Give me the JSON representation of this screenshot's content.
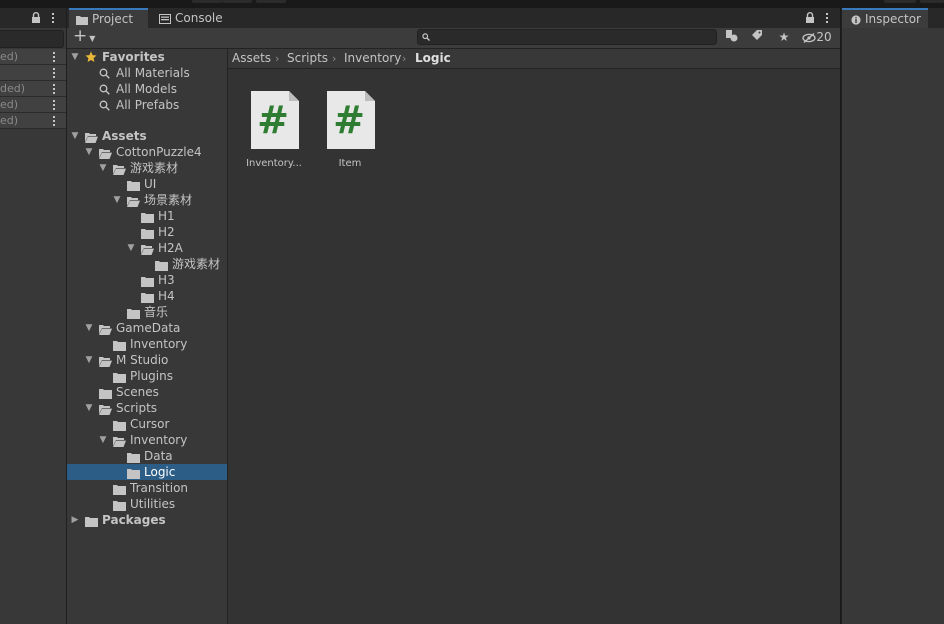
{
  "hierarchy": {
    "rows": [
      "ed)",
      "",
      "ded)",
      "ed)",
      "ed)"
    ]
  },
  "project": {
    "tabs": [
      {
        "label": "Project",
        "icon": "folder-icon",
        "active": true
      },
      {
        "label": "Console",
        "icon": "console-icon",
        "active": false
      }
    ],
    "search_placeholder": "",
    "hidden_count": "20",
    "tree": [
      {
        "label": "Favorites",
        "icon": "star-icon",
        "bold": true,
        "expanded": true
      },
      {
        "label": "All Materials",
        "icon": "search-icon"
      },
      {
        "label": "All Models",
        "icon": "search-icon"
      },
      {
        "label": "All Prefabs",
        "icon": "search-icon"
      },
      {
        "label": "Assets",
        "icon": "folder-open-icon",
        "bold": true,
        "expanded": true
      },
      {
        "label": "CottonPuzzle4",
        "icon": "folder-open-icon",
        "expanded": true
      },
      {
        "label": "游戏素材",
        "icon": "folder-open-icon",
        "expanded": true
      },
      {
        "label": "UI",
        "icon": "folder-icon"
      },
      {
        "label": "场景素材",
        "icon": "folder-open-icon",
        "expanded": true
      },
      {
        "label": "H1",
        "icon": "folder-icon"
      },
      {
        "label": "H2",
        "icon": "folder-icon"
      },
      {
        "label": "H2A",
        "icon": "folder-open-icon",
        "expanded": true
      },
      {
        "label": "游戏素材",
        "icon": "folder-icon"
      },
      {
        "label": "H3",
        "icon": "folder-icon"
      },
      {
        "label": "H4",
        "icon": "folder-icon"
      },
      {
        "label": "音乐",
        "icon": "folder-icon"
      },
      {
        "label": "GameData",
        "icon": "folder-open-icon",
        "expanded": true
      },
      {
        "label": "Inventory",
        "icon": "folder-icon"
      },
      {
        "label": "M Studio",
        "icon": "folder-open-icon",
        "expanded": true
      },
      {
        "label": "Plugins",
        "icon": "folder-icon"
      },
      {
        "label": "Scenes",
        "icon": "folder-icon"
      },
      {
        "label": "Scripts",
        "icon": "folder-open-icon",
        "expanded": true
      },
      {
        "label": "Cursor",
        "icon": "folder-icon"
      },
      {
        "label": "Inventory",
        "icon": "folder-open-icon",
        "expanded": true
      },
      {
        "label": "Data",
        "icon": "folder-icon"
      },
      {
        "label": "Logic",
        "icon": "folder-icon",
        "selected": true
      },
      {
        "label": "Transition",
        "icon": "folder-icon"
      },
      {
        "label": "Utilities",
        "icon": "folder-icon"
      },
      {
        "label": "Packages",
        "icon": "folder-icon",
        "bold": true,
        "expanded": false
      }
    ],
    "breadcrumb": [
      "Assets",
      "Scripts",
      "Inventory",
      "Logic"
    ],
    "assets": [
      {
        "label": "Inventory...",
        "icon": "csharp-script-icon",
        "glyph": "#"
      },
      {
        "label": "Item",
        "icon": "csharp-script-icon",
        "glyph": "#"
      }
    ]
  },
  "inspector": {
    "tab_label": "Inspector",
    "icon": "info-icon"
  },
  "colors": {
    "selection": "#2c5d87",
    "script_green": "#2e7d32",
    "favorite_star": "#e8b73a"
  }
}
